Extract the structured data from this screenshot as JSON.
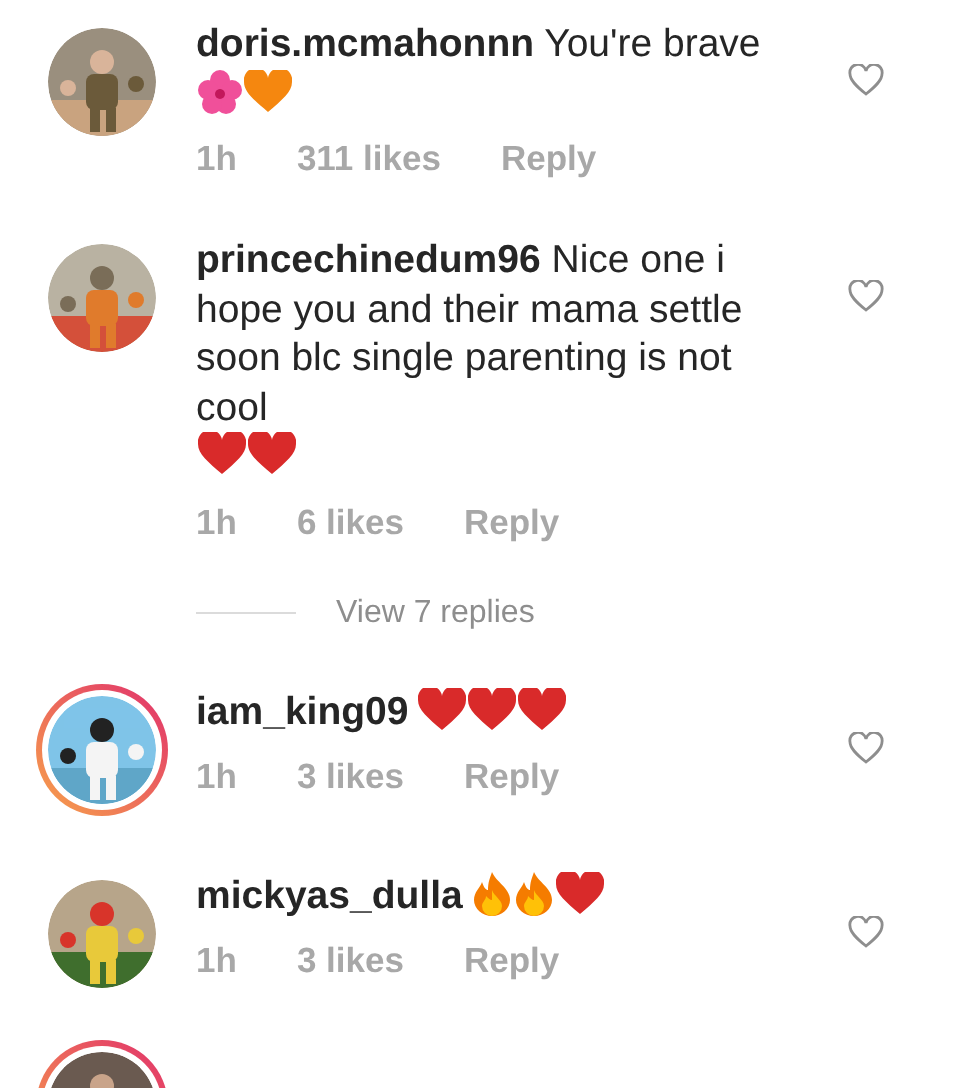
{
  "comments": [
    {
      "avatar": {
        "story": false
      },
      "text": "**doris.mcmahonnn** You're brave",
      "emojis": [
        {
          "kind": "hibiscus"
        },
        {
          "kind": "orange-heart"
        }
      ],
      "time": "1h",
      "likes": "311 likes",
      "reply": "Reply",
      "liked": false
    },
    {
      "avatar": {
        "story": false
      },
      "text": "**princechinedum96** Nice one i hope you and their mama settle soon blc single parenting is not cool",
      "emojis": [
        {
          "kind": "red-heart"
        },
        {
          "kind": "red-heart"
        }
      ],
      "time": "1h",
      "likes": "6 likes",
      "reply": "Reply",
      "liked": false,
      "view_replies": "View 7 replies"
    },
    {
      "avatar": {
        "story": true
      },
      "text": "**iam_king09**",
      "emojis": [
        {
          "kind": "red-heart"
        },
        {
          "kind": "red-heart"
        },
        {
          "kind": "red-heart"
        }
      ],
      "time": "1h",
      "likes": "3 likes",
      "reply": "Reply",
      "liked": false
    },
    {
      "avatar": {
        "story": false
      },
      "text": "**mickyas_dulla**",
      "emojis": [
        {
          "kind": "fire"
        },
        {
          "kind": "fire"
        },
        {
          "kind": "red-heart"
        }
      ],
      "time": "1h",
      "likes": "3 likes",
      "reply": "Reply",
      "liked": false
    },
    {
      "avatar": {
        "story": true
      }
    }
  ]
}
